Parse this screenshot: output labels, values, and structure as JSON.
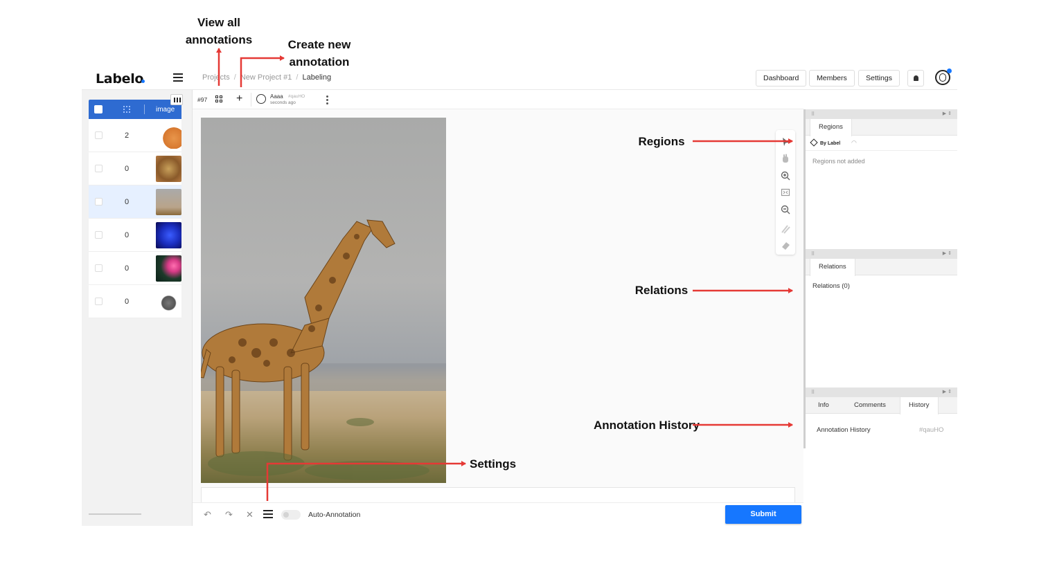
{
  "app": {
    "logo": "Labelo"
  },
  "breadcrumb": {
    "items": [
      "Projects",
      "New Project #1",
      "Labeling"
    ],
    "separator": "/"
  },
  "header_buttons": {
    "dashboard": "Dashboard",
    "members": "Members",
    "settings": "Settings"
  },
  "table": {
    "column_label": "image",
    "rows": [
      {
        "count": "2",
        "thumb": "cat"
      },
      {
        "count": "0",
        "thumb": "leopard"
      },
      {
        "count": "0",
        "thumb": "giraffe",
        "selected": true
      },
      {
        "count": "0",
        "thumb": "blue-flower"
      },
      {
        "count": "0",
        "thumb": "pink-flower"
      },
      {
        "count": "0",
        "thumb": "raccoon"
      }
    ]
  },
  "subbar": {
    "task_id": "#97",
    "annotator": {
      "name": "Aaaa",
      "id": "#qauHO",
      "time": "seconds ago"
    }
  },
  "bottom": {
    "auto_annotation": "Auto-Annotation",
    "submit": "Submit"
  },
  "panels": {
    "regions": {
      "tab": "Regions",
      "by_label": "By Label",
      "empty": "Regions not added"
    },
    "relations": {
      "tab": "Relations",
      "count": "Relations (0)"
    },
    "history": {
      "tabs": [
        "Info",
        "Comments",
        "History"
      ],
      "active_tab": "History",
      "title": "Annotation History",
      "id": "#qauHO"
    }
  },
  "callouts": {
    "view_all": "View all annotations",
    "create_new": "Create new annotation",
    "regions": "Regions",
    "relations": "Relations",
    "annotation_history": "Annotation History",
    "settings": "Settings"
  },
  "colors": {
    "accent": "#1677ff",
    "header_blue": "#2e6bd1",
    "arrow_red": "#e53935"
  }
}
